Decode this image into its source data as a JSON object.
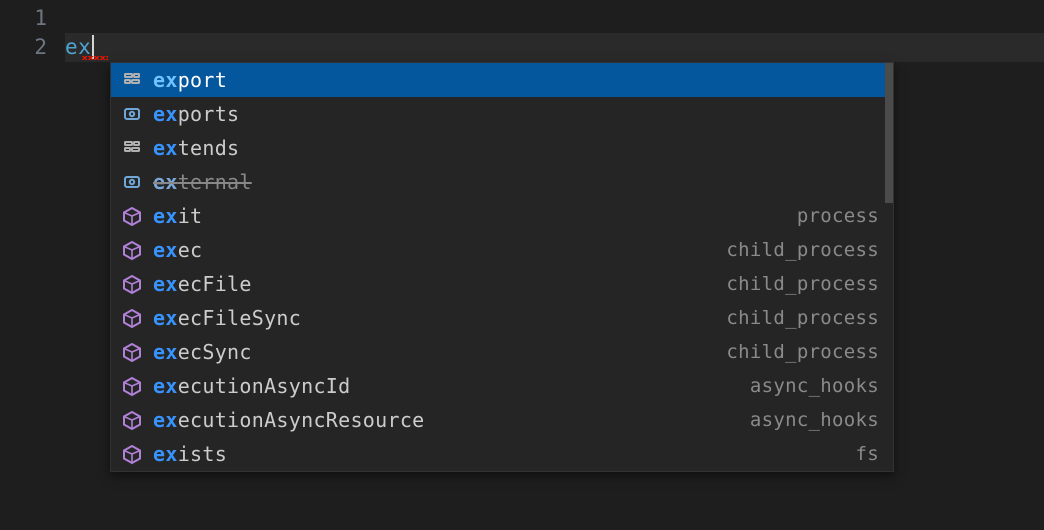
{
  "lines": {
    "l1": "1",
    "l2": "2"
  },
  "typed": {
    "value": "ex",
    "match": "ex",
    "rest": ""
  },
  "suggest": {
    "items": [
      {
        "icon": "keyword",
        "match": "ex",
        "rest": "port",
        "detail": "",
        "selected": true,
        "deprecated": false
      },
      {
        "icon": "var",
        "match": "ex",
        "rest": "ports",
        "detail": "",
        "selected": false,
        "deprecated": false
      },
      {
        "icon": "keyword",
        "match": "ex",
        "rest": "tends",
        "detail": "",
        "selected": false,
        "deprecated": false
      },
      {
        "icon": "var",
        "match": "ex",
        "rest": "ternal",
        "detail": "",
        "selected": false,
        "deprecated": true
      },
      {
        "icon": "method",
        "match": "ex",
        "rest": "it",
        "detail": "process",
        "selected": false,
        "deprecated": false
      },
      {
        "icon": "method",
        "match": "ex",
        "rest": "ec",
        "detail": "child_process",
        "selected": false,
        "deprecated": false
      },
      {
        "icon": "method",
        "match": "ex",
        "rest": "ecFile",
        "detail": "child_process",
        "selected": false,
        "deprecated": false
      },
      {
        "icon": "method",
        "match": "ex",
        "rest": "ecFileSync",
        "detail": "child_process",
        "selected": false,
        "deprecated": false
      },
      {
        "icon": "method",
        "match": "ex",
        "rest": "ecSync",
        "detail": "child_process",
        "selected": false,
        "deprecated": false
      },
      {
        "icon": "method",
        "match": "ex",
        "rest": "ecutionAsyncId",
        "detail": "async_hooks",
        "selected": false,
        "deprecated": false
      },
      {
        "icon": "method",
        "match": "ex",
        "rest": "ecutionAsyncResource",
        "detail": "async_hooks",
        "selected": false,
        "deprecated": false
      },
      {
        "icon": "method",
        "match": "ex",
        "rest": "ists",
        "detail": "fs",
        "selected": false,
        "deprecated": false
      }
    ],
    "scroll": {
      "thumbHeightPx": 140
    }
  }
}
